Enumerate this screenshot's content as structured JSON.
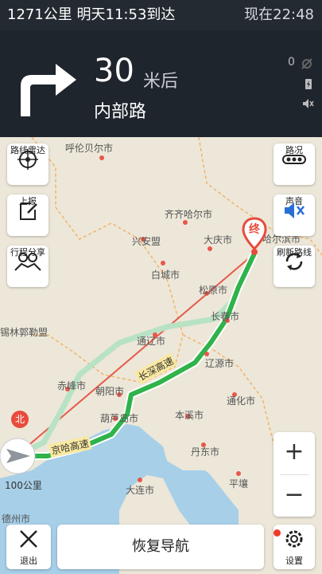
{
  "status": {
    "trip": "1271公里  明天11:53到达",
    "clock": "现在22:48"
  },
  "nav": {
    "distance": "30",
    "unit": "米后",
    "road": "内部路",
    "speed_count": "0"
  },
  "map": {
    "labels": [
      "呼伦贝尔市",
      "齐齐哈尔市",
      "兴安盟",
      "大庆市",
      "哈尔滨市",
      "白城市",
      "松原市",
      "长春市",
      "通辽市",
      "锡林郭勒盟",
      "赤峰市",
      "朝阳市",
      "辽源市",
      "通化市",
      "葫芦岛市",
      "本溪市",
      "丹东市",
      "大连市",
      "平壤",
      "德州市",
      "长深高速",
      "京哈高速"
    ],
    "end_marker": "终",
    "north": "北",
    "scale": "100公里"
  },
  "buttons": {
    "radar": "路线雷达",
    "report": "上报",
    "share": "行程分享",
    "traffic": "路况",
    "sound": "声音",
    "refresh": "刷新路线",
    "zoom_in": "+",
    "zoom_out": "−",
    "exit": "退出",
    "resume": "恢复导航",
    "settings": "设置"
  }
}
